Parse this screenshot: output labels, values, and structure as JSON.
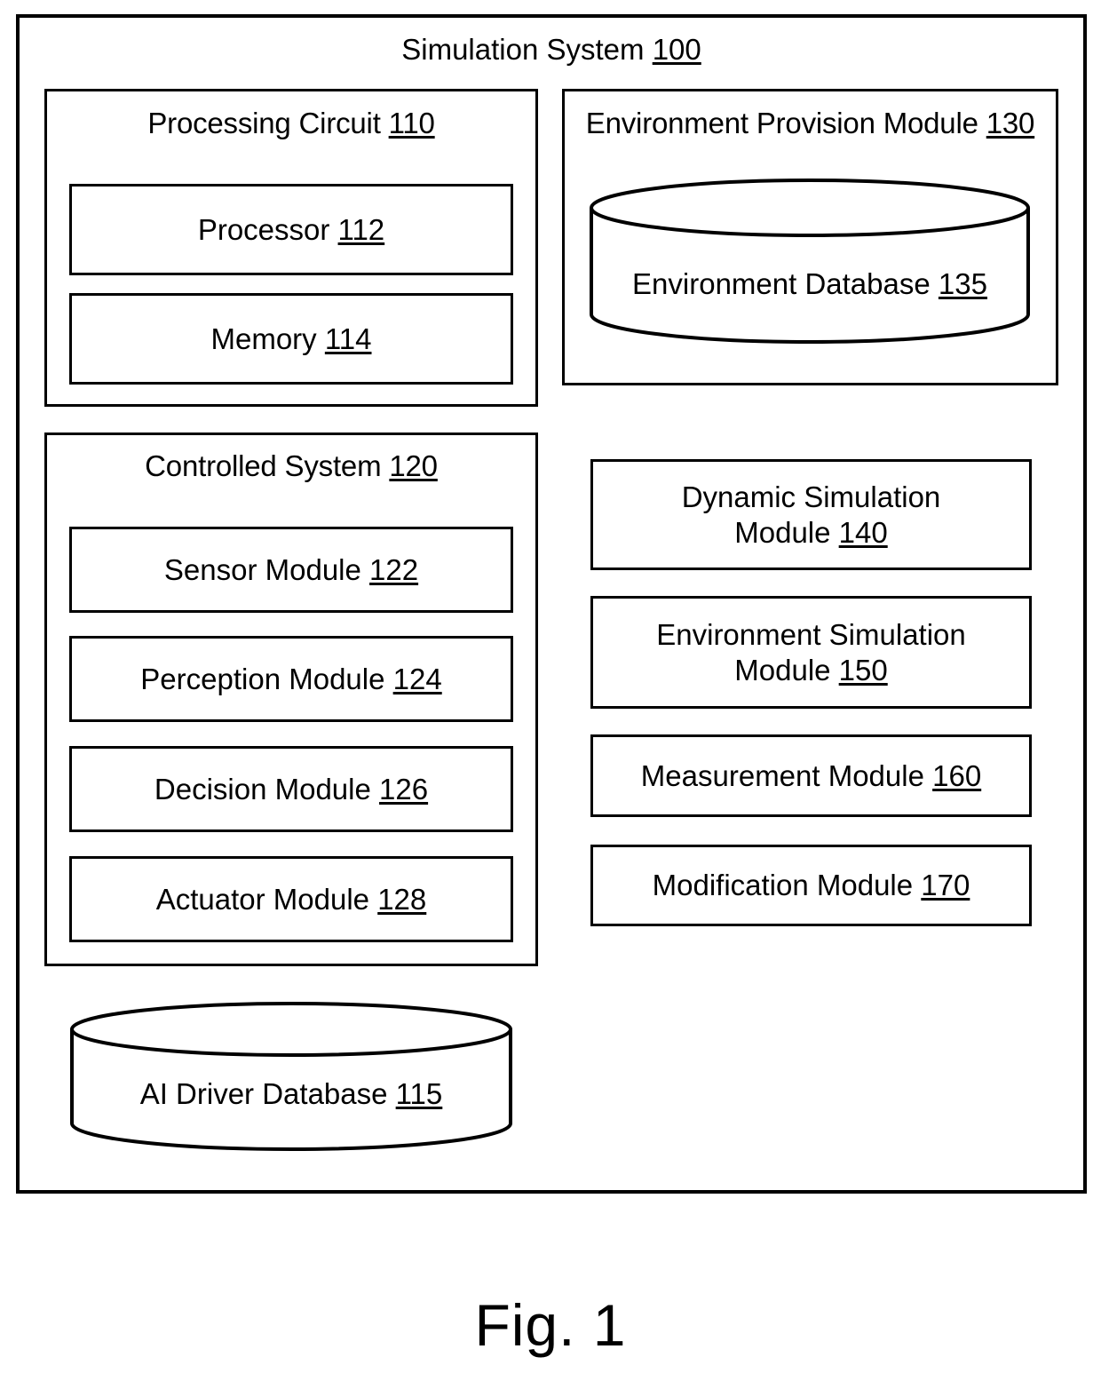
{
  "figure": {
    "caption": "Fig. 1",
    "system_title_text": "Simulation System",
    "system_title_ref": "100"
  },
  "processing_circuit": {
    "title_text": "Processing Circuit",
    "title_ref": "110",
    "modules": [
      {
        "text": "Processor",
        "ref": "112"
      },
      {
        "text": "Memory",
        "ref": "114"
      }
    ]
  },
  "controlled_system": {
    "title_text": "Controlled System",
    "title_ref": "120",
    "modules": [
      {
        "text": "Sensor Module",
        "ref": "122"
      },
      {
        "text": "Perception Module",
        "ref": "124"
      },
      {
        "text": "Decision Module",
        "ref": "126"
      },
      {
        "text": "Actuator Module",
        "ref": "128"
      }
    ]
  },
  "ai_driver_database": {
    "text": "AI Driver Database",
    "ref": "115",
    "shape": "cylinder-icon"
  },
  "environment_provision_module": {
    "title_text": "Environment Provision Module",
    "title_ref": "130",
    "database": {
      "text": "Environment Database",
      "ref": "135",
      "shape": "cylinder-icon"
    }
  },
  "right_modules": [
    {
      "line1": "Dynamic Simulation",
      "line2": "Module",
      "ref": "140"
    },
    {
      "line1": "Environment Simulation",
      "line2": "Module",
      "ref": "150"
    },
    {
      "line1": "Measurement Module",
      "line2": "",
      "ref": "160"
    },
    {
      "line1": "Modification Module",
      "line2": "",
      "ref": "170"
    }
  ],
  "colors": {
    "ink": "#000000",
    "paper": "#ffffff"
  }
}
